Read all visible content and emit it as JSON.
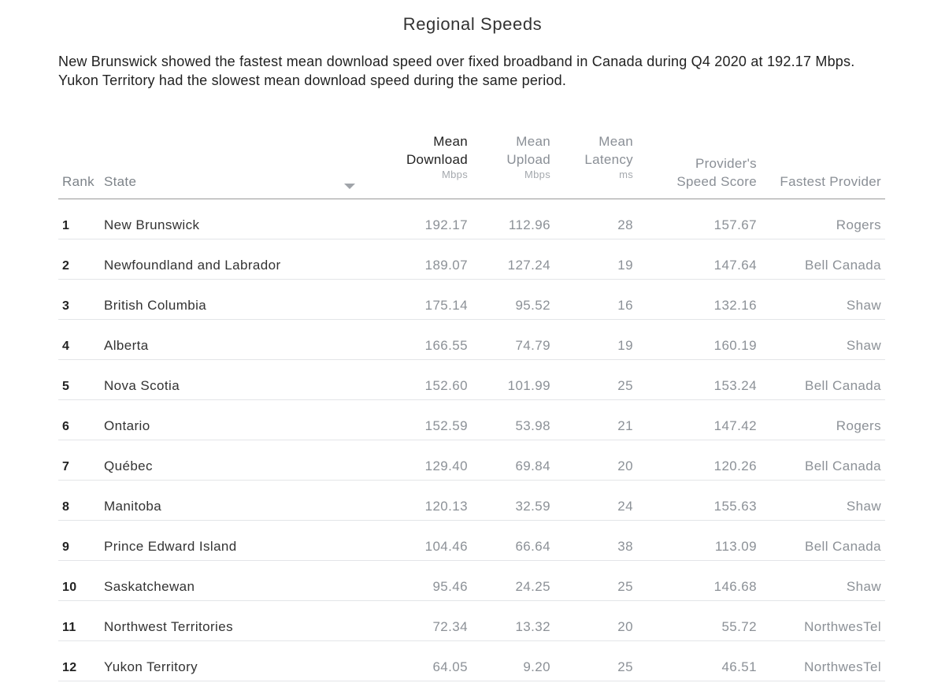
{
  "title": "Regional Speeds",
  "description": "New Brunswick showed the fastest mean download speed over fixed broadband in Canada during Q4 2020 at 192.17 Mbps. Yukon Territory had the slowest mean download speed during the same period.",
  "table": {
    "headers": {
      "rank": "Rank",
      "state": "State",
      "download_l1": "Mean",
      "download_l2": "Download",
      "download_unit": "Mbps",
      "upload_l1": "Mean",
      "upload_l2": "Upload",
      "upload_unit": "Mbps",
      "latency_l1": "Mean",
      "latency_l2": "Latency",
      "latency_unit": "ms",
      "score_l1": "Provider's",
      "score_l2": "Speed Score",
      "provider": "Fastest Provider"
    },
    "sort_icon": "sort-descending-icon",
    "rows": [
      {
        "rank": "1",
        "state": "New Brunswick",
        "download": "192.17",
        "upload": "112.96",
        "latency": "28",
        "score": "157.67",
        "provider": "Rogers"
      },
      {
        "rank": "2",
        "state": "Newfoundland and Labrador",
        "download": "189.07",
        "upload": "127.24",
        "latency": "19",
        "score": "147.64",
        "provider": "Bell Canada"
      },
      {
        "rank": "3",
        "state": "British Columbia",
        "download": "175.14",
        "upload": "95.52",
        "latency": "16",
        "score": "132.16",
        "provider": "Shaw"
      },
      {
        "rank": "4",
        "state": "Alberta",
        "download": "166.55",
        "upload": "74.79",
        "latency": "19",
        "score": "160.19",
        "provider": "Shaw"
      },
      {
        "rank": "5",
        "state": "Nova Scotia",
        "download": "152.60",
        "upload": "101.99",
        "latency": "25",
        "score": "153.24",
        "provider": "Bell Canada"
      },
      {
        "rank": "6",
        "state": "Ontario",
        "download": "152.59",
        "upload": "53.98",
        "latency": "21",
        "score": "147.42",
        "provider": "Rogers"
      },
      {
        "rank": "7",
        "state": "Québec",
        "download": "129.40",
        "upload": "69.84",
        "latency": "20",
        "score": "120.26",
        "provider": "Bell Canada"
      },
      {
        "rank": "8",
        "state": "Manitoba",
        "download": "120.13",
        "upload": "32.59",
        "latency": "24",
        "score": "155.63",
        "provider": "Shaw"
      },
      {
        "rank": "9",
        "state": "Prince Edward Island",
        "download": "104.46",
        "upload": "66.64",
        "latency": "38",
        "score": "113.09",
        "provider": "Bell Canada"
      },
      {
        "rank": "10",
        "state": "Saskatchewan",
        "download": "95.46",
        "upload": "24.25",
        "latency": "25",
        "score": "146.68",
        "provider": "Shaw"
      },
      {
        "rank": "11",
        "state": "Northwest Territories",
        "download": "72.34",
        "upload": "13.32",
        "latency": "20",
        "score": "55.72",
        "provider": "NorthwesTel"
      },
      {
        "rank": "12",
        "state": "Yukon Territory",
        "download": "64.05",
        "upload": "9.20",
        "latency": "25",
        "score": "46.51",
        "provider": "NorthwesTel"
      }
    ]
  },
  "colors": {
    "header_text": "#8a8f96",
    "active_header": "#222222",
    "numeric_text": "#8c9197",
    "row_divider": "#e3e5e8",
    "header_divider": "#999999"
  }
}
